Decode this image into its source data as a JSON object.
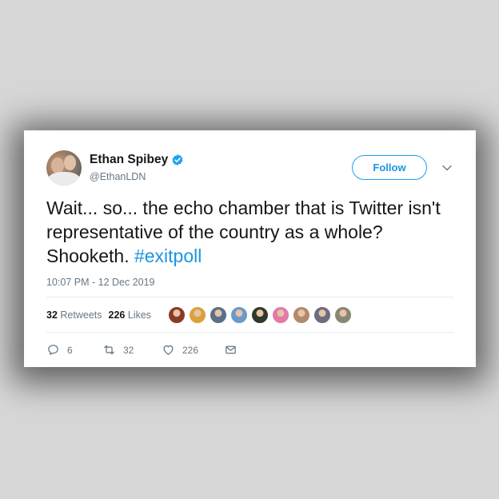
{
  "tweet": {
    "author_name": "Ethan Spibey",
    "author_handle": "@EthanLDN",
    "follow_label": "Follow",
    "text_before": "Wait... so... the echo chamber that is Twitter isn't representative of the country as a whole? Shooketh. ",
    "hashtag": "#exitpoll",
    "timestamp": "10:07 PM - 12 Dec 2019",
    "retweets_count": "32",
    "retweets_label": "Retweets",
    "likes_count": "226",
    "likes_label": "Likes",
    "replies": "6",
    "retweets_action": "32",
    "likes_action": "226"
  },
  "colors": {
    "accent": "#1da1f2",
    "link": "#1b95e0",
    "text": "#14171a",
    "muted": "#657786",
    "verified": "#1da1f2"
  },
  "liker_avatars": [
    {
      "name": "liker-avatar-1",
      "color": "#8b3a2a"
    },
    {
      "name": "liker-avatar-2",
      "color": "#d9a23a"
    },
    {
      "name": "liker-avatar-3",
      "color": "#5a6f8a"
    },
    {
      "name": "liker-avatar-4",
      "color": "#6a9ac9"
    },
    {
      "name": "liker-avatar-5",
      "color": "#2f3a2a"
    },
    {
      "name": "liker-avatar-6",
      "color": "#e07aa6"
    },
    {
      "name": "liker-avatar-7",
      "color": "#b08a6a"
    },
    {
      "name": "liker-avatar-8",
      "color": "#6c6c7e"
    },
    {
      "name": "liker-avatar-9",
      "color": "#8a8676"
    }
  ]
}
